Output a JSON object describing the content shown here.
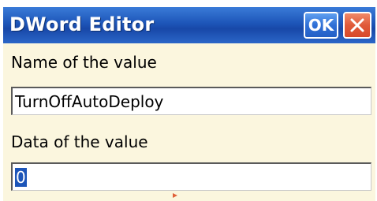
{
  "window": {
    "title": "DWord Editor",
    "ok_label": "OK",
    "close_icon": "close-icon"
  },
  "form": {
    "name_label": "Name of the value",
    "name_value": "TurnOffAutoDeploy",
    "data_label": "Data of the value",
    "data_value": "0"
  },
  "colors": {
    "titlebar": "#1d55b8",
    "content_bg": "#fbf6de",
    "ok_button": "#2f6fd6",
    "close_button": "#e05a3a",
    "selection": "#1d55b8"
  }
}
